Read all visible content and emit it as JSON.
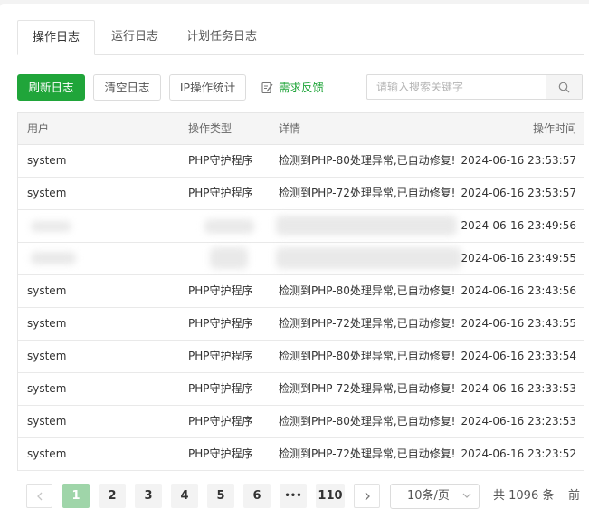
{
  "tabs": [
    {
      "label": "操作日志",
      "active": true
    },
    {
      "label": "运行日志",
      "active": false
    },
    {
      "label": "计划任务日志",
      "active": false
    }
  ],
  "toolbar": {
    "refresh_label": "刷新日志",
    "clear_label": "清空日志",
    "ip_stats_label": "IP操作统计",
    "feedback_label": "需求反馈",
    "search_placeholder": "请输入搜索关键字",
    "accent_color": "#20a53a"
  },
  "table": {
    "columns": {
      "user": "用户",
      "type": "操作类型",
      "detail": "详情",
      "time": "操作时间"
    },
    "rows": [
      {
        "user": "system",
        "type": "PHP守护程序",
        "detail": "检测到PHP-80处理异常,已自动修复!",
        "time": "2024-06-16 23:53:57",
        "redacted": false
      },
      {
        "user": "system",
        "type": "PHP守护程序",
        "detail": "检测到PHP-72处理异常,已自动修复!",
        "time": "2024-06-16 23:53:57",
        "redacted": false
      },
      {
        "user": "",
        "type": "",
        "detail": "",
        "time": "2024-06-16 23:49:56",
        "redacted": true
      },
      {
        "user": "",
        "type": "",
        "detail": "",
        "time": "2024-06-16 23:49:55",
        "redacted": true
      },
      {
        "user": "system",
        "type": "PHP守护程序",
        "detail": "检测到PHP-80处理异常,已自动修复!",
        "time": "2024-06-16 23:43:56",
        "redacted": false
      },
      {
        "user": "system",
        "type": "PHP守护程序",
        "detail": "检测到PHP-72处理异常,已自动修复!",
        "time": "2024-06-16 23:43:55",
        "redacted": false
      },
      {
        "user": "system",
        "type": "PHP守护程序",
        "detail": "检测到PHP-80处理异常,已自动修复!",
        "time": "2024-06-16 23:33:54",
        "redacted": false
      },
      {
        "user": "system",
        "type": "PHP守护程序",
        "detail": "检测到PHP-72处理异常,已自动修复!",
        "time": "2024-06-16 23:33:53",
        "redacted": false
      },
      {
        "user": "system",
        "type": "PHP守护程序",
        "detail": "检测到PHP-80处理异常,已自动修复!",
        "time": "2024-06-16 23:23:53",
        "redacted": false
      },
      {
        "user": "system",
        "type": "PHP守护程序",
        "detail": "检测到PHP-72处理异常,已自动修复!",
        "time": "2024-06-16 23:23:52",
        "redacted": false
      }
    ]
  },
  "pagination": {
    "prev_icon": "chevron-left-icon",
    "pages": [
      "1",
      "2",
      "3",
      "4",
      "5",
      "6",
      "•••",
      "110"
    ],
    "current": "1",
    "next_icon": "chevron-right-icon",
    "per_page": "10条/页",
    "total": "共 1096 条",
    "jump_label": "前"
  }
}
